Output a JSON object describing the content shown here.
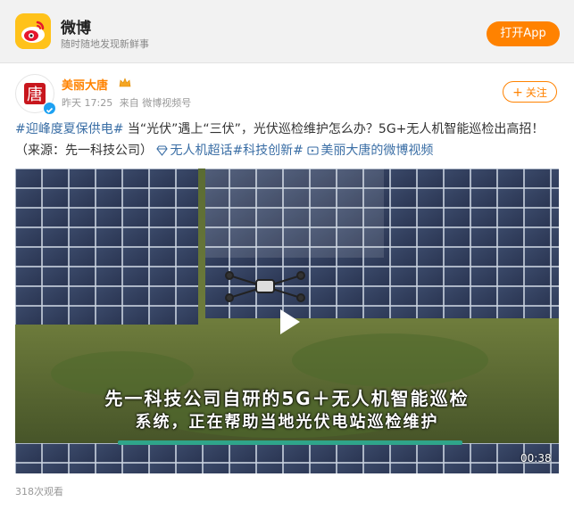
{
  "header": {
    "app_name": "微博",
    "tagline": "随时随地发现新鲜事",
    "open_app_label": "打开App"
  },
  "post": {
    "author": "美丽大唐",
    "avatar_char": "唐",
    "time": "昨天 17:25",
    "source": "来自 微博视频号",
    "follow_label": "关注",
    "topic1": "#迎峰度夏保供电#",
    "text": " 当“光伏”遇上“三伏”，光伏巡检维护怎么办？5G+无人机智能巡检出高招！（来源：先一科技公司）",
    "link1": "无人机超话",
    "topic2": "#科技创新#",
    "link2": "美丽大唐的微博视频"
  },
  "video": {
    "caption_line1": "先一科技公司自研的5G＋无人机智能巡检",
    "caption_line2": "系统，正在帮助当地光伏电站巡检维护",
    "duration": "00:38",
    "progress": 0.63
  },
  "footer": {
    "views": "318次观看"
  },
  "colors": {
    "brand_orange": "#ff8200",
    "link_blue": "#3a6ea5"
  },
  "icons": [
    "weibo-logo-icon",
    "crown-icon",
    "verified-icon",
    "plus-icon",
    "diamond-icon",
    "video-icon",
    "play-icon"
  ]
}
